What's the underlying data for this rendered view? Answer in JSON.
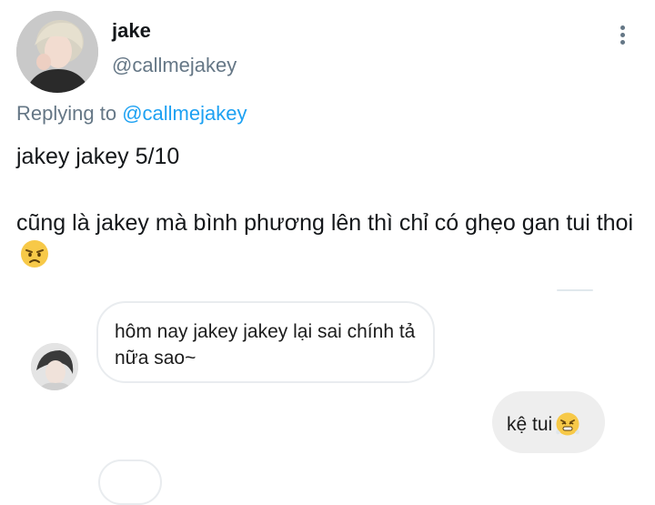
{
  "header": {
    "display_name": "jake",
    "handle": "@callmejakey",
    "more_icon": "more-vertical-icon"
  },
  "reply": {
    "prefix": "Replying to ",
    "target": "@callmejakey"
  },
  "tweet": {
    "line1": "jakey jakey 5/10",
    "line2": "cũng là jakey mà bình phương lên thì chỉ có ghẹo gan tui thoi",
    "line2_emoji": "annoyed-face-emoji"
  },
  "chat": {
    "incoming": "hôm nay jakey jakey lại sai chính tả nữa sao~",
    "outgoing": "kệ tui",
    "outgoing_emoji": "face-with-steam-emoji"
  },
  "colors": {
    "secondary_text": "#657786",
    "link": "#1da1f2",
    "outgoing_bubble": "#eeeeee"
  }
}
